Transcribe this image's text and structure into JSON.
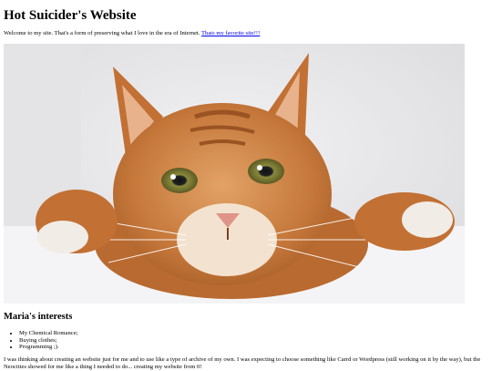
{
  "header": {
    "title": "Hot Suicider's Website"
  },
  "intro": {
    "text": "Welcome to my site. That's a form of preserving what I love in the era of Internet.",
    "link_label": "Thats my favorite site!!!"
  },
  "image": {
    "alt": "Orange tabby cat peeking over a ledge",
    "colors": {
      "fur": "#c97a3a",
      "background": "#e9e9eb",
      "eyes": "#7a7a35"
    }
  },
  "interests": {
    "heading": "Maria's interests",
    "items": [
      "My Chemical Romance;",
      "Buying clothes;",
      "Programming ;)."
    ]
  },
  "story": {
    "text": "I was thinking about creating an website just for me and to use like a type of archive of my own. I was expecting to choose something like Carrd or Wordpress (still working on it by the way), but the Neocities showed for me like a thing I needed to do... creating my website from 0!"
  }
}
